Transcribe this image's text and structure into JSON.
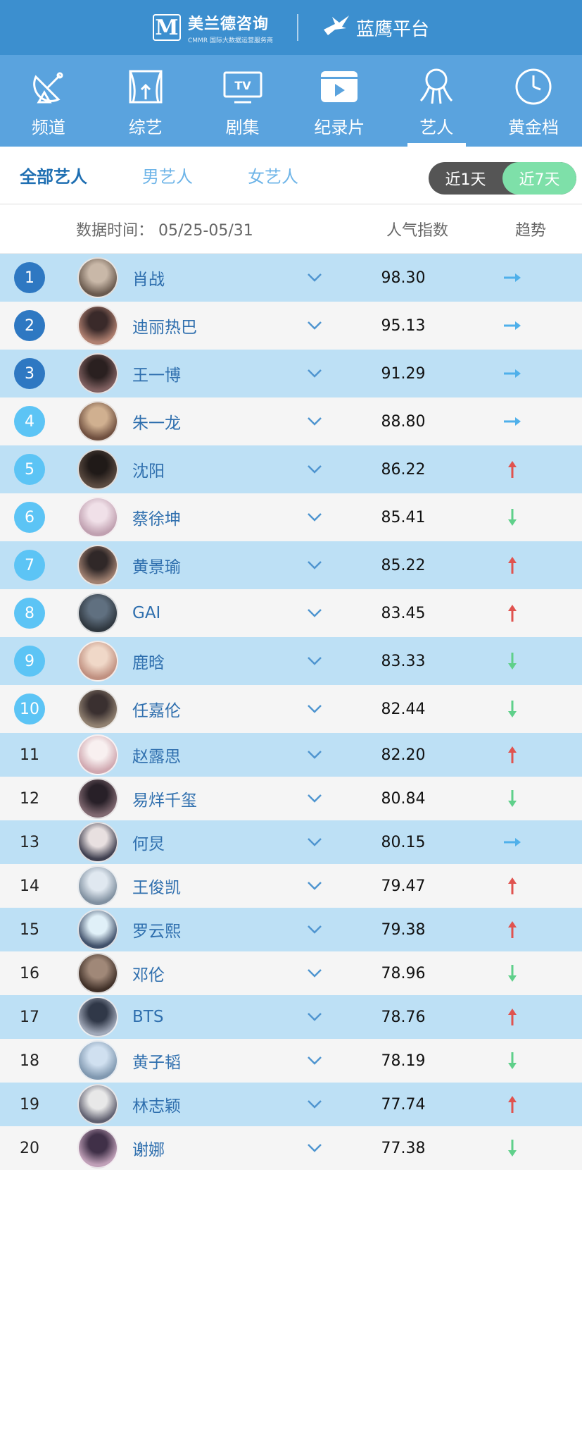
{
  "brand": {
    "left_logo": "M",
    "left_name": "美兰德咨询",
    "left_sub": "CMMR 国际大数据运营服务商",
    "right_name": "蓝鹰平台"
  },
  "nav": [
    {
      "label": "频道",
      "icon": "satellite-dish-icon"
    },
    {
      "label": "综艺",
      "icon": "stage-curtain-icon"
    },
    {
      "label": "剧集",
      "icon": "tv-icon"
    },
    {
      "label": "纪录片",
      "icon": "film-play-icon"
    },
    {
      "label": "艺人",
      "icon": "artist-icon",
      "active": true
    },
    {
      "label": "黄金档",
      "icon": "clock-icon"
    }
  ],
  "tabs": {
    "all": "全部艺人",
    "male": "男艺人",
    "female": "女艺人",
    "day1": "近1天",
    "day7": "近7天"
  },
  "columns": {
    "date": "数据时间： 05/25-05/31",
    "popularity": "人气指数",
    "trend": "趋势"
  },
  "colors": {
    "up": "#e0534f",
    "down": "#5fd08a",
    "flat": "#4fb0ea"
  },
  "rows": [
    {
      "rank": "1",
      "name": "肖战",
      "score": "98.30",
      "trend": "flat"
    },
    {
      "rank": "2",
      "name": "迪丽热巴",
      "score": "95.13",
      "trend": "flat"
    },
    {
      "rank": "3",
      "name": "王一博",
      "score": "91.29",
      "trend": "flat"
    },
    {
      "rank": "4",
      "name": "朱一龙",
      "score": "88.80",
      "trend": "flat"
    },
    {
      "rank": "5",
      "name": "沈阳",
      "score": "86.22",
      "trend": "up"
    },
    {
      "rank": "6",
      "name": "蔡徐坤",
      "score": "85.41",
      "trend": "down"
    },
    {
      "rank": "7",
      "name": "黄景瑜",
      "score": "85.22",
      "trend": "up"
    },
    {
      "rank": "8",
      "name": "GAI",
      "score": "83.45",
      "trend": "up"
    },
    {
      "rank": "9",
      "name": "鹿晗",
      "score": "83.33",
      "trend": "down"
    },
    {
      "rank": "10",
      "name": "任嘉伦",
      "score": "82.44",
      "trend": "down"
    },
    {
      "rank": "11",
      "name": "赵露思",
      "score": "82.20",
      "trend": "up"
    },
    {
      "rank": "12",
      "name": "易烊千玺",
      "score": "80.84",
      "trend": "down"
    },
    {
      "rank": "13",
      "name": "何炅",
      "score": "80.15",
      "trend": "flat"
    },
    {
      "rank": "14",
      "name": "王俊凯",
      "score": "79.47",
      "trend": "up"
    },
    {
      "rank": "15",
      "name": "罗云熙",
      "score": "79.38",
      "trend": "up"
    },
    {
      "rank": "16",
      "name": "邓伦",
      "score": "78.96",
      "trend": "down"
    },
    {
      "rank": "17",
      "name": "BTS",
      "score": "78.76",
      "trend": "up"
    },
    {
      "rank": "18",
      "name": "黄子韬",
      "score": "78.19",
      "trend": "down"
    },
    {
      "rank": "19",
      "name": "林志颖",
      "score": "77.74",
      "trend": "up"
    },
    {
      "rank": "20",
      "name": "谢娜",
      "score": "77.38",
      "trend": "down"
    }
  ]
}
